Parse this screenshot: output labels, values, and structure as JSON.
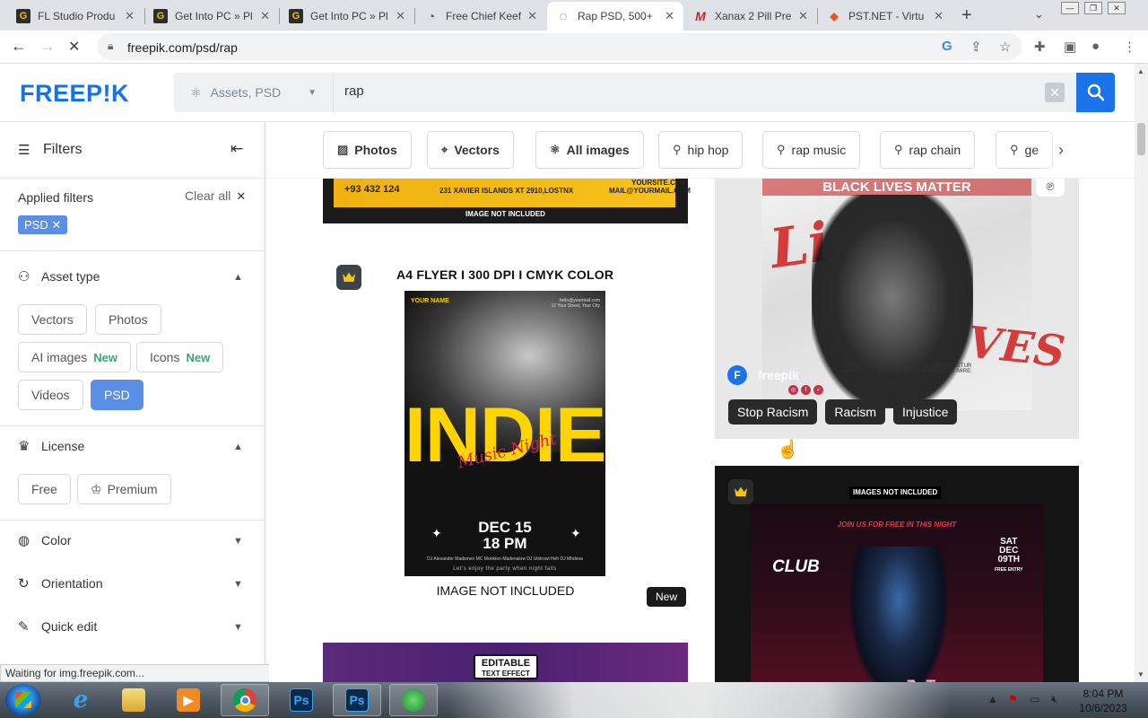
{
  "browser": {
    "tabs": [
      {
        "title": "FL Studio Produ",
        "icon": "G"
      },
      {
        "title": "Get Into PC » Pl",
        "icon": "G"
      },
      {
        "title": "Get Into PC » Pl",
        "icon": "G"
      },
      {
        "title": "Free Chief Keef",
        "icon": "◔"
      },
      {
        "title": "Rap PSD, 500+",
        "icon": "◌"
      },
      {
        "title": "Xanax 2 Pill Pre",
        "icon": "M"
      },
      {
        "title": "PST.NET - Virtu",
        "icon": "◆"
      }
    ],
    "url": "freepik.com/psd/rap",
    "status_text": "Waiting for img.freepik.com..."
  },
  "header": {
    "logo": "FREEP!K",
    "asset_selector": "Assets, PSD",
    "search_query": "rap"
  },
  "sidebar": {
    "title": "Filters",
    "applied_label": "Applied filters",
    "clear_all": "Clear all",
    "applied_chip": "PSD",
    "asset_type": {
      "title": "Asset type",
      "chips": [
        {
          "label": "Vectors"
        },
        {
          "label": "Photos"
        },
        {
          "label": "AI images",
          "badge": "New"
        },
        {
          "label": "Icons",
          "badge": "New"
        },
        {
          "label": "Videos"
        },
        {
          "label": "PSD"
        }
      ]
    },
    "license": {
      "title": "License",
      "chips": [
        "Free",
        "Premium"
      ]
    },
    "color": "Color",
    "orientation": "Orientation",
    "quick_edit": "Quick edit"
  },
  "categories": [
    {
      "label": "Photos",
      "icon": "image-icon"
    },
    {
      "label": "Vectors",
      "icon": "vector-icon"
    },
    {
      "label": "All images",
      "icon": "ai-icon"
    },
    {
      "label": "hip hop",
      "icon": "search-icon"
    },
    {
      "label": "rap music",
      "icon": "search-icon"
    },
    {
      "label": "rap chain",
      "icon": "search-icon"
    },
    {
      "label": "ge",
      "icon": "search-icon"
    }
  ],
  "cards": {
    "card1": {
      "phone": "+93 432 124",
      "address": "231 XAVIER ISLANDS XT 2910,LOSTNX",
      "site": "YOURSITE.COM",
      "mail": "MAIL@YOURMAIL.COM",
      "note": "IMAGE NOT INCLUDED"
    },
    "card2": {
      "heading": "A4 FLYER  I  300 DPI  I CMYK COLOR",
      "your_name": "YOUR NAME",
      "address_line1": "hello@yourmail.com",
      "address_line2": "12 Your Street, Your City",
      "title": "INDIE",
      "script": "Music Night",
      "date_line1": "DEC 15",
      "date_line2": "18 PM",
      "djs": "DJ Alexander Madsmen   MC Monkton Madenalow   DJ Ulstrowl Heh   DJ Mhdesa",
      "footer": "Let's enjoy the party when night falls",
      "note": "IMAGE NOT INCLUDED",
      "new_badge": "New"
    },
    "card3": {
      "label_line1": "EDITABLE",
      "label_line2": "TEXT EFFECT"
    },
    "card4": {
      "headline": "BLACK LIVES MATTER",
      "brand": "freepik",
      "lorem_line1": "LOREM IPSUM DOLOR SIT AMET, CONSECTETUR",
      "lorem_line2": "ADIPISCING ELIT. MAECENAS CONSEQUAT MIRE.",
      "tags": [
        "Stop Racism",
        "Racism",
        "Injustice"
      ]
    },
    "card5": {
      "note": "IMAGES NOT INCLUDED",
      "join": "JOIN US FOR FREE IN THIS NIGHT",
      "club": "CLUB",
      "sat": "SAT",
      "date": "DEC",
      "day": "09TH",
      "entry": "FREE ENTRY"
    }
  },
  "taskbar": {
    "time": "8:04 PM",
    "date": "10/6/2023"
  },
  "colors": {
    "brand_blue": "#1273eb",
    "chip_selected": "#5b8fe6",
    "new_green": "#36a86b"
  }
}
